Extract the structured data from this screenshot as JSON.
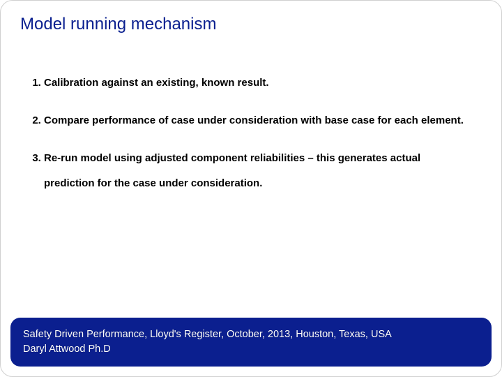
{
  "title": "Model running mechanism",
  "list": {
    "item1": "Calibration against an existing, known result.",
    "item2": "Compare performance of case under consideration with base case for each element.",
    "item3": "Re-run model using adjusted component reliabilities – this generates actual prediction for the case under consideration."
  },
  "footer": {
    "line1": "Safety Driven Performance, Lloyd's Register, October, 2013, Houston, Texas, USA",
    "line2": "Daryl Attwood Ph.D"
  }
}
